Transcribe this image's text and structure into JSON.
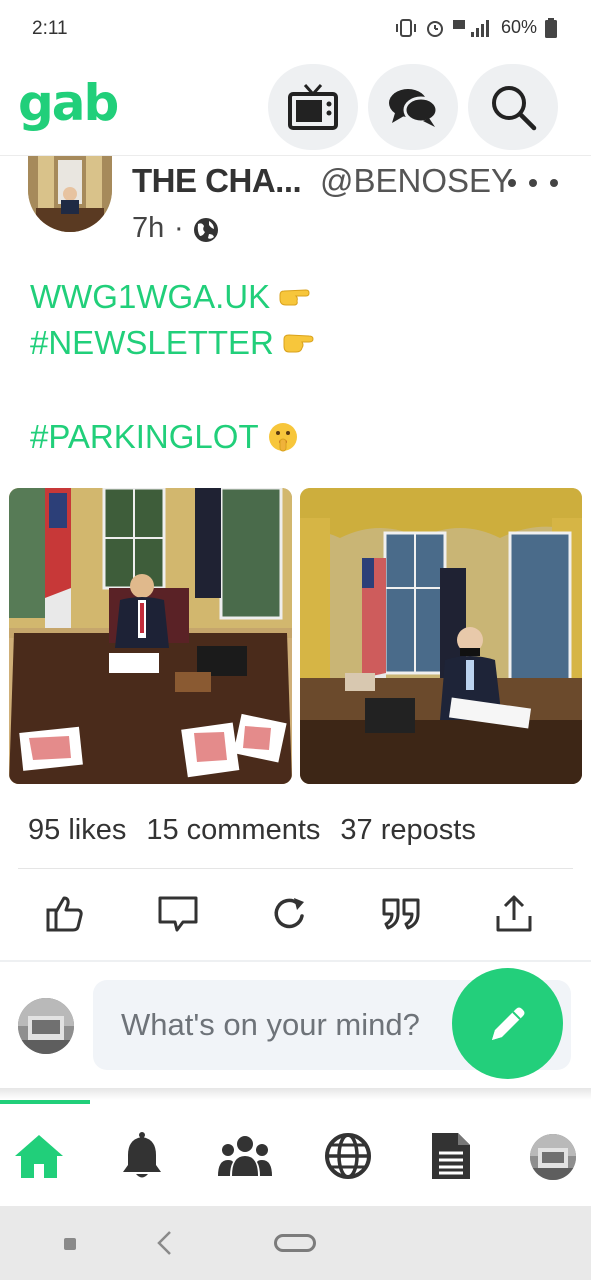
{
  "status_bar": {
    "time": "2:11",
    "battery": "60%"
  },
  "header": {
    "logo": "gab",
    "buttons": [
      {
        "icon": "tv-icon"
      },
      {
        "icon": "chat-icon"
      },
      {
        "icon": "search-icon"
      }
    ]
  },
  "post": {
    "author_name": "THE CHA...",
    "handle": "@BENOSEY",
    "time": "7h",
    "separator": "·",
    "lines": [
      "WWG1WGA.UK",
      "#NEWSLETTER",
      "#PARKINGLOT"
    ],
    "stats": {
      "likes": "95 likes",
      "comments": "15 comments",
      "reposts": "37 reposts"
    },
    "actions": [
      "like-icon",
      "comment-icon",
      "repost-icon",
      "quote-icon",
      "share-icon"
    ]
  },
  "composer": {
    "placeholder": "What's on your mind?"
  },
  "bottom_nav": {
    "items": [
      "home-icon",
      "notifications-icon",
      "groups-icon",
      "explore-icon",
      "news-icon",
      "profile-avatar"
    ],
    "active": "home-icon"
  },
  "colors": {
    "brand": "#21cf7a",
    "button_bg": "#eef0f2",
    "text": "#333333"
  }
}
